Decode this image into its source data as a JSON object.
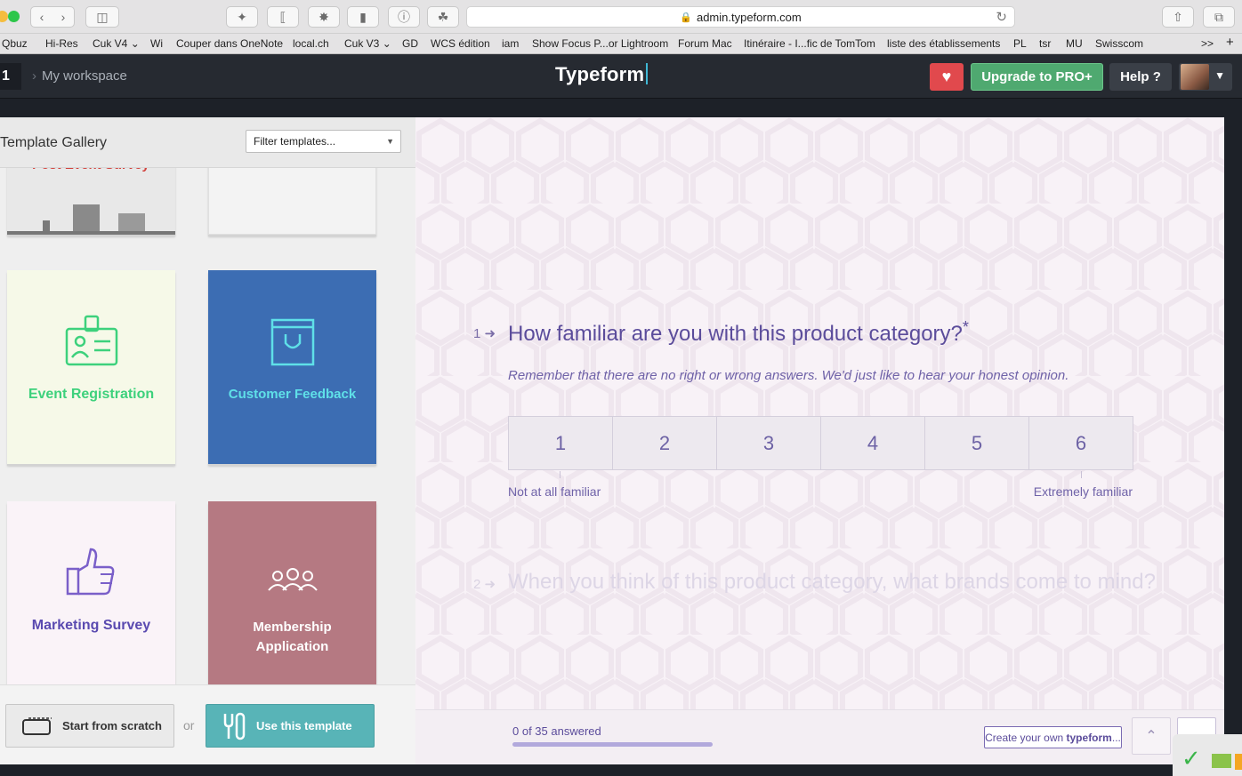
{
  "browser": {
    "url": "admin.typeform.com",
    "bookmarks": [
      "Qbuz",
      "Hi-Res",
      "Cuk V4",
      "Wi",
      "Couper dans OneNote",
      "local.ch",
      "Cuk V3",
      "GD",
      "WCS édition",
      "iam",
      "Show Focus P...or Lightroom",
      "Forum Mac",
      "Itinéraire - I...fic de TomTom",
      "liste des établissements",
      "PL",
      "tsr",
      "MU",
      "Swisscom"
    ],
    "more": ">>"
  },
  "header": {
    "workspace_number": "1",
    "breadcrumb": "My workspace",
    "logo": "Typeform",
    "upgrade_label": "Upgrade to PRO+",
    "help_label": "Help ?"
  },
  "gallery": {
    "title": "Template Gallery",
    "filter_placeholder": "Filter templates...",
    "cards": [
      {
        "label": "Post Event Survey",
        "color": "#e8e8e8"
      },
      {
        "label": "",
        "color": "#f1f1f1"
      },
      {
        "label": "Event Registration",
        "color": "#f6f9e8",
        "text_color": "#3dd17c"
      },
      {
        "label": "Customer Feedback",
        "color": "#3c6db3",
        "text_color": "#5fe0e8"
      },
      {
        "label": "Marketing Survey",
        "color": "#faf3f8",
        "text_color": "#5a4ab0"
      },
      {
        "label": "Membership Application",
        "color": "#b57982",
        "text_color": "#ffffff"
      }
    ],
    "start_scratch": "Start from scratch",
    "or": "or",
    "use_template": "Use this template"
  },
  "preview": {
    "q1_number": "1",
    "q1_text": "How familiar are you with this product category?",
    "q1_required": "*",
    "q1_description": "Remember that there are no right or wrong answers. We'd just like to hear your honest opinion.",
    "scale": [
      "1",
      "2",
      "3",
      "4",
      "5",
      "6"
    ],
    "scale_low": "Not at all familiar",
    "scale_high": "Extremely familiar",
    "q2_number": "2",
    "q2_text": "When you think of this product category, what brands come to mind?",
    "progress_text": "0 of 35 answered",
    "progress": 0,
    "create_own_prefix": "Create your own ",
    "create_own_brand": "typeform",
    "create_own_suffix": "..."
  }
}
